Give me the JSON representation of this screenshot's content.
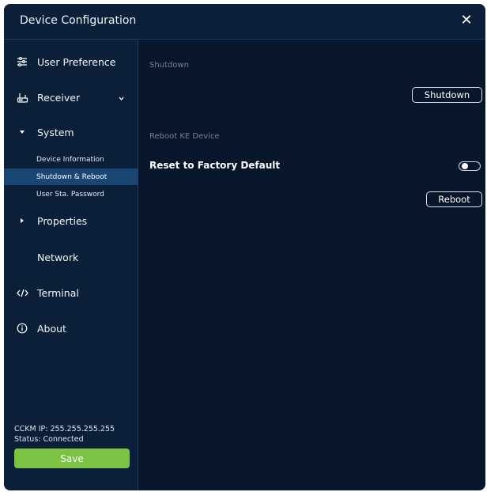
{
  "window": {
    "title": "Device Configuration"
  },
  "sidebar": {
    "items": [
      {
        "label": "User Preference"
      },
      {
        "label": "Receiver"
      },
      {
        "label": "System"
      },
      {
        "label": "Properties"
      },
      {
        "label": "Network"
      },
      {
        "label": "Terminal"
      },
      {
        "label": "About"
      }
    ],
    "sub_items": [
      {
        "label": "Device Information"
      },
      {
        "label": "Shutdown & Reboot",
        "active": true
      },
      {
        "label": "User Sta. Password"
      }
    ],
    "status": {
      "ip": "CCKM IP:  255.255.255.255",
      "connection": "Status: Connected"
    },
    "save_label": "Save"
  },
  "main": {
    "shutdown_section": "Shutdown",
    "shutdown_button": "Shutdown",
    "reboot_section": "Reboot KE Device",
    "factory_label": "Reset to Factory Default",
    "factory_toggle_on": false,
    "reboot_button": "Reboot"
  },
  "colors": {
    "background": "#07162a",
    "panel": "#0b2038",
    "active": "#1a4674",
    "save": "#7cc243"
  }
}
